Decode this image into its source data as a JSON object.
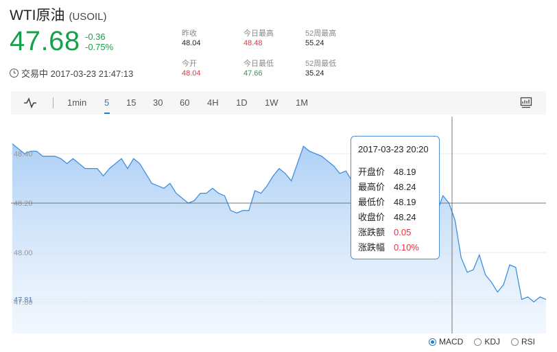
{
  "header": {
    "name": "WTI原油",
    "code": "(USOIL)",
    "price": "47.68",
    "change": "-0.36",
    "change_pct": "-0.75%",
    "status": "交易中 2017-03-23 21:47:13"
  },
  "stats": [
    {
      "label": "昨收",
      "value": "48.04"
    },
    {
      "label": "今日最高",
      "value": "48.48"
    },
    {
      "label": "52周最高",
      "value": "55.24"
    },
    {
      "label": "今开",
      "value": "48.04"
    },
    {
      "label": "今日最低",
      "value": "47.66"
    },
    {
      "label": "52周最低",
      "value": "35.24"
    }
  ],
  "toolbar": {
    "intervals": [
      "1min",
      "5",
      "15",
      "30",
      "60",
      "4H",
      "1D",
      "1W",
      "1M"
    ],
    "active": "5"
  },
  "tooltip": {
    "time": "2017-03-23 20:20",
    "rows": [
      {
        "label": "开盘价",
        "value": "48.19"
      },
      {
        "label": "最高价",
        "value": "48.24"
      },
      {
        "label": "最低价",
        "value": "48.19"
      },
      {
        "label": "收盘价",
        "value": "48.24"
      },
      {
        "label": "涨跌额",
        "value": "0.05"
      },
      {
        "label": "涨跌幅",
        "value": "0.10%"
      }
    ]
  },
  "indicators": {
    "options": [
      "MACD",
      "KDJ",
      "RSI"
    ],
    "selected": "MACD"
  },
  "colors": {
    "up": "#e5343c",
    "down": "#17a04a",
    "accent": "#1e7fd0"
  },
  "chart_data": {
    "type": "area",
    "y_ticks": [
      "48.40",
      "48.20",
      "48.00",
      "47.81",
      "47.80"
    ],
    "ylim": [
      47.73,
      48.52
    ],
    "crosshair_value": 48.2,
    "values": [
      48.44,
      48.42,
      48.4,
      48.41,
      48.41,
      48.39,
      48.39,
      48.39,
      48.38,
      48.36,
      48.38,
      48.36,
      48.34,
      48.34,
      48.34,
      48.31,
      48.34,
      48.36,
      48.38,
      48.34,
      48.38,
      48.36,
      48.32,
      48.28,
      48.27,
      48.26,
      48.28,
      48.24,
      48.22,
      48.2,
      48.21,
      48.24,
      48.24,
      48.26,
      48.24,
      48.23,
      48.17,
      48.16,
      48.17,
      48.17,
      48.25,
      48.24,
      48.27,
      48.31,
      48.34,
      48.32,
      48.29,
      48.36,
      48.43,
      48.41,
      48.4,
      48.39,
      48.37,
      48.35,
      48.32,
      48.33,
      48.29,
      48.27,
      48.29,
      48.3,
      48.31,
      48.28,
      48.29,
      48.24,
      48.22,
      48.21,
      48.22,
      48.19,
      48.18,
      48.16,
      48.16,
      48.23,
      48.2,
      48.13,
      47.98,
      47.92,
      47.93,
      47.99,
      47.91,
      47.88,
      47.84,
      47.87,
      47.95,
      47.94,
      47.81,
      47.82,
      47.8,
      47.82,
      47.81
    ]
  }
}
